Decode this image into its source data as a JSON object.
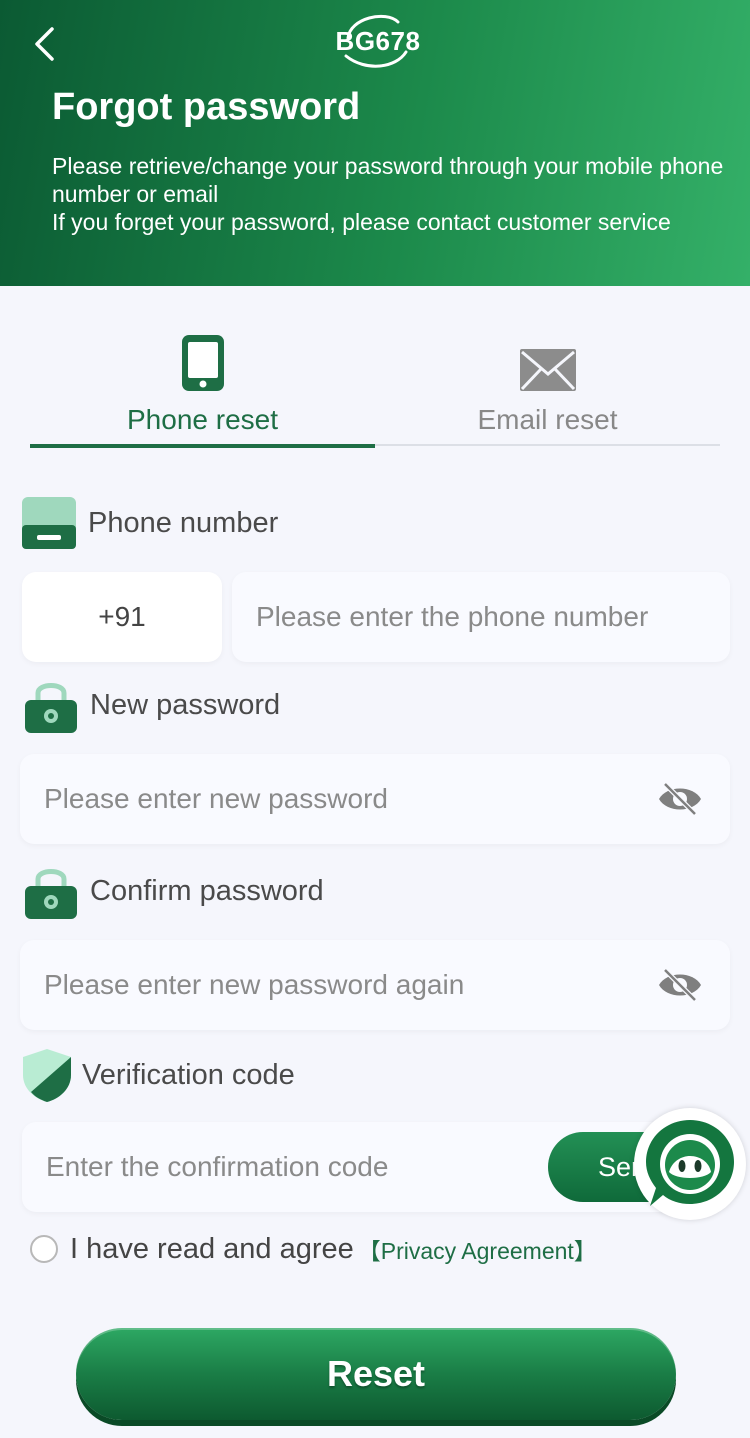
{
  "header": {
    "logo_text": "BG678",
    "title": "Forgot password",
    "desc_line1": "Please retrieve/change your password through your mobile phone number or email",
    "desc_line2": "If you forget your password, please contact customer service"
  },
  "tabs": [
    {
      "label": "Phone reset",
      "active": true,
      "icon": "phone-icon"
    },
    {
      "label": "Email reset",
      "active": false,
      "icon": "envelope-icon"
    }
  ],
  "form": {
    "phone": {
      "label": "Phone number",
      "country_code": "+91",
      "placeholder": "Please enter the phone number"
    },
    "new_password": {
      "label": "New password",
      "placeholder": "Please enter new password"
    },
    "confirm_password": {
      "label": "Confirm password",
      "placeholder": "Please enter new password again"
    },
    "verification": {
      "label": "Verification code",
      "placeholder": "Enter the confirmation code",
      "send_label": "Send"
    }
  },
  "agreement": {
    "text": "I have read and agree",
    "link": "【Privacy Agreement】"
  },
  "reset_label": "Reset",
  "colors": {
    "brand_green": "#1e6e45",
    "header_gradient_start": "#0b5a33",
    "header_gradient_end": "#34b068"
  }
}
